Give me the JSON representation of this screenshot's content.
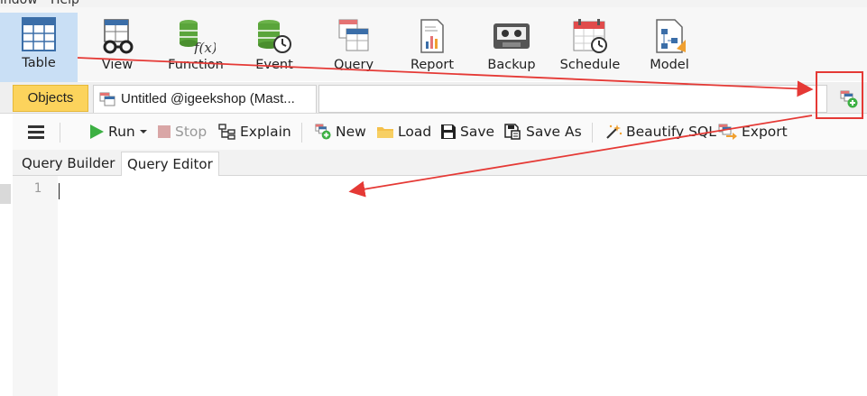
{
  "menubar": {
    "items": [
      "indow",
      "Help"
    ]
  },
  "toolbar": {
    "items": [
      {
        "id": "table",
        "label": "Table",
        "icon": "table-icon",
        "active": true
      },
      {
        "id": "view",
        "label": "View",
        "icon": "view-icon"
      },
      {
        "id": "function",
        "label": "Function",
        "icon": "function-icon"
      },
      {
        "id": "event",
        "label": "Event",
        "icon": "event-icon"
      },
      {
        "id": "query",
        "label": "Query",
        "icon": "query-icon"
      },
      {
        "id": "report",
        "label": "Report",
        "icon": "report-icon"
      },
      {
        "id": "backup",
        "label": "Backup",
        "icon": "backup-icon"
      },
      {
        "id": "schedule",
        "label": "Schedule",
        "icon": "schedule-icon"
      },
      {
        "id": "model",
        "label": "Model",
        "icon": "model-icon"
      }
    ]
  },
  "tabs": {
    "objects": "Objects",
    "untitled": "Untitled @igeekshop (Mast...",
    "new_tab_icon": "new-query-tab-icon"
  },
  "editor_toolbar": {
    "menu_icon": "hamburger-icon",
    "run": "Run",
    "stop": "Stop",
    "explain": "Explain",
    "new": "New",
    "load": "Load",
    "save": "Save",
    "save_as": "Save As",
    "beautify": "Beautify SQL",
    "export": "Export"
  },
  "subtabs": {
    "builder": "Query Builder",
    "editor": "Query Editor"
  },
  "editor": {
    "line_number": "1"
  },
  "colors": {
    "active_tool_bg": "#c9dff5",
    "objects_tab": "#fcd35c",
    "annotation_red": "#e53935",
    "run_green": "#3cb043"
  }
}
